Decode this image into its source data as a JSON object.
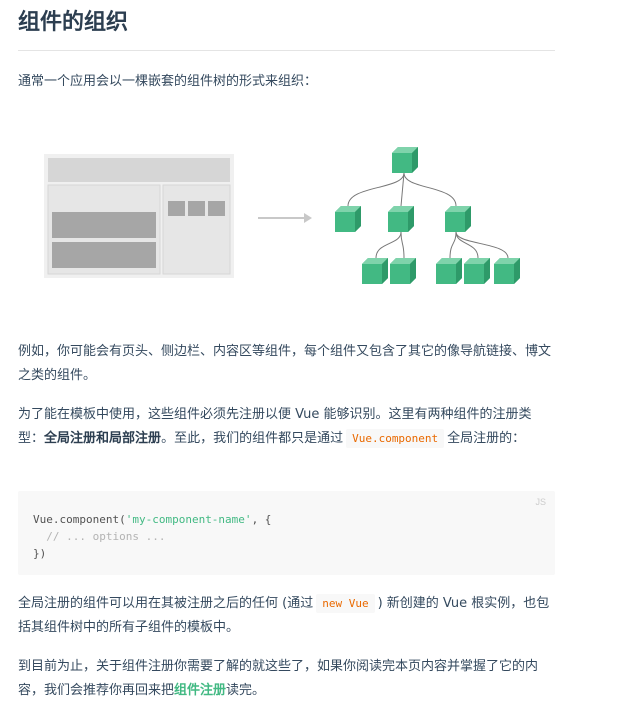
{
  "heading": "组件的组织",
  "intro": "通常一个应用会以一棵嵌套的组件树的形式来组织：",
  "para_layout": "例如，你可能会有页头、侧边栏、内容区等组件，每个组件又包含了其它的像导航链接、博文之类的组件。",
  "register": {
    "text_a": "为了能在模板中使用，这些组件必须先注册以便 Vue 能够识别。这里有两种组件的注册类型：",
    "global_label": "全局注册",
    "and": "和",
    "local_label": "局部注册",
    "text_b": "。至此，我们的组件都只是通过",
    "code": "Vue.component",
    "text_c": "全局注册的："
  },
  "code_block": {
    "lang": "JS",
    "line1_pre": "Vue.component(",
    "line1_str": "'my-component-name'",
    "line1_post": ", {",
    "line2": "  // ... options ...",
    "line3": "})"
  },
  "para_global": {
    "text_a": "全局注册的组件可以用在其被注册之后的任何 (通过",
    "code": "new Vue",
    "text_b": ") 新创建的 Vue 根实例，也包括其组件树中的所有子组件的模板中。"
  },
  "para_end": {
    "text_a": "到目前为止，关于组件注册你需要了解的就这些了，如果你阅读完本页内容并掌握了它的内容，我们会推荐你再回来把",
    "link": "组件注册",
    "text_b": "读完。"
  },
  "colors": {
    "accent": "#42b983",
    "heading": "#2c3e50",
    "code_inline": "#e96900"
  }
}
